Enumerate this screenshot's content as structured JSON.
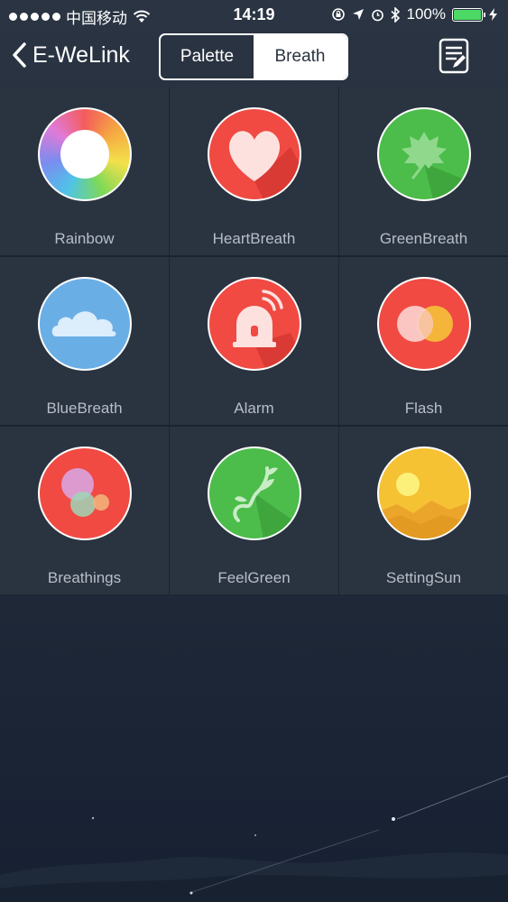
{
  "status_bar": {
    "carrier": "中国移动",
    "time": "14:19",
    "battery": "100%"
  },
  "nav": {
    "back_label": "E-WeLink",
    "tabs": [
      {
        "label": "Palette",
        "active": false
      },
      {
        "label": "Breath",
        "active": true
      }
    ]
  },
  "modes": [
    {
      "label": "Rainbow",
      "icon": "rainbow-icon"
    },
    {
      "label": "HeartBreath",
      "icon": "heart-icon"
    },
    {
      "label": "GreenBreath",
      "icon": "leaf-icon"
    },
    {
      "label": "BlueBreath",
      "icon": "cloud-icon"
    },
    {
      "label": "Alarm",
      "icon": "alarm-light-icon"
    },
    {
      "label": "Flash",
      "icon": "flash-circles-icon"
    },
    {
      "label": "Breathings",
      "icon": "bubbles-icon"
    },
    {
      "label": "FeelGreen",
      "icon": "sprout-icon"
    },
    {
      "label": "SettingSun",
      "icon": "sunset-icon"
    }
  ],
  "colors": {
    "red": "#f04a43",
    "green": "#4cbc4a",
    "blue": "#6aaee6",
    "yellow": "#f5c233"
  }
}
